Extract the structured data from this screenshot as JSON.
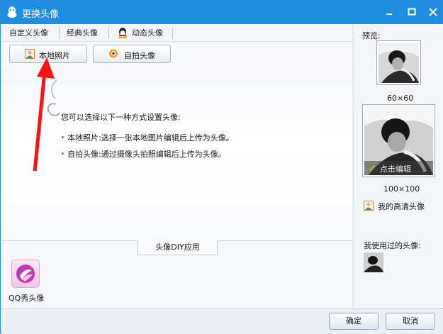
{
  "window": {
    "title": "更换头像"
  },
  "tabs": [
    "自定义头像",
    "经典头像",
    "动态头像"
  ],
  "buttons": {
    "local_photo": "本地照片",
    "selfie": "自拍头像"
  },
  "content": {
    "intro": "您可以选择以下一种方式设置头像:",
    "items": [
      "本地照片:选择一张本地图片编辑后上传为头像。",
      "自拍头像:通过摄像头拍照编辑后上传为头像。"
    ]
  },
  "diy_button": "头像DIY应用",
  "apps": [
    {
      "label": "QQ秀头像"
    }
  ],
  "preview": {
    "label": "预览:",
    "small_size": "60×60",
    "large_size": "100×100",
    "edit_label": "点击编辑",
    "hd_link": "我的高清头像",
    "used_label": "我使用过的头像:"
  },
  "footer": {
    "ok": "确定",
    "cancel": "取消"
  },
  "colors": {
    "titlebar": "#1f8ee0",
    "arrow": "#ff1010"
  }
}
